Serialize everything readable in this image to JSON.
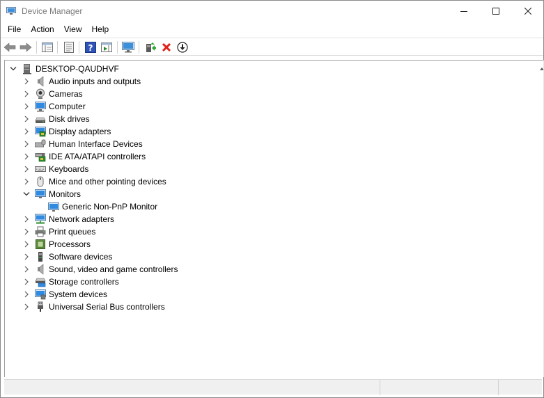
{
  "window": {
    "title": "Device Manager"
  },
  "menu": {
    "items": [
      "File",
      "Action",
      "View",
      "Help"
    ]
  },
  "toolbar": {
    "buttons": [
      "back-arrow-icon",
      "forward-arrow-icon",
      "show-hide-console-tree-icon",
      "properties-icon",
      "help-icon",
      "action-pane-icon",
      "scan-hardware-icon",
      "update-driver-icon",
      "uninstall-icon",
      "download-icon"
    ]
  },
  "tree": {
    "root": "DESKTOP-QAUDHVF",
    "categories": [
      {
        "label": "Audio inputs and outputs",
        "icon": "speaker-icon"
      },
      {
        "label": "Cameras",
        "icon": "camera-icon"
      },
      {
        "label": "Computer",
        "icon": "computer-icon"
      },
      {
        "label": "Disk drives",
        "icon": "disk-drive-icon"
      },
      {
        "label": "Display adapters",
        "icon": "display-adapter-icon"
      },
      {
        "label": "Human Interface Devices",
        "icon": "hid-icon"
      },
      {
        "label": "IDE ATA/ATAPI controllers",
        "icon": "ide-controller-icon"
      },
      {
        "label": "Keyboards",
        "icon": "keyboard-icon"
      },
      {
        "label": "Mice and other pointing devices",
        "icon": "mouse-icon"
      },
      {
        "label": "Monitors",
        "icon": "monitor-icon",
        "expanded": true,
        "children": [
          "Generic Non-PnP Monitor"
        ]
      },
      {
        "label": "Network adapters",
        "icon": "network-adapter-icon"
      },
      {
        "label": "Print queues",
        "icon": "printer-icon"
      },
      {
        "label": "Processors",
        "icon": "processor-icon"
      },
      {
        "label": "Software devices",
        "icon": "software-device-icon"
      },
      {
        "label": "Sound, video and game controllers",
        "icon": "sound-controller-icon"
      },
      {
        "label": "Storage controllers",
        "icon": "storage-controller-icon"
      },
      {
        "label": "System devices",
        "icon": "system-devices-icon"
      },
      {
        "label": "Universal Serial Bus controllers",
        "icon": "usb-icon"
      }
    ]
  },
  "colors": {
    "accent_blue": "#1e7bd6",
    "uninstall_red": "#e0201a",
    "chevron_gray": "#5a5a5a",
    "status_bar": "#f0f0f0"
  }
}
